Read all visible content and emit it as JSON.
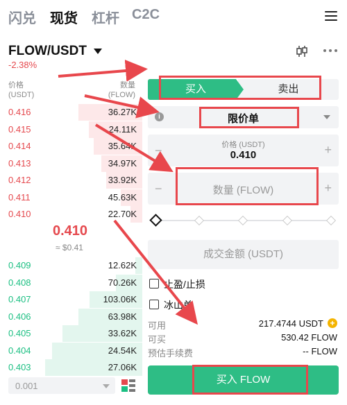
{
  "top_tabs": [
    "闪兑",
    "现货",
    "杠杆",
    "C2C"
  ],
  "pair": {
    "name": "FLOW/USDT",
    "change": "-2.38%"
  },
  "orderbook": {
    "price_header": "价格\n(USDT)",
    "qty_header": "数量\n(FLOW)",
    "asks": [
      {
        "price": "0.416",
        "qty": "36.27K",
        "depth": 0.66
      },
      {
        "price": "0.415",
        "qty": "24.11K",
        "depth": 0.55
      },
      {
        "price": "0.414",
        "qty": "35.64K",
        "depth": 0.5
      },
      {
        "price": "0.413",
        "qty": "34.97K",
        "depth": 0.42
      },
      {
        "price": "0.412",
        "qty": "33.92K",
        "depth": 0.37
      },
      {
        "price": "0.411",
        "qty": "45.63K",
        "depth": 0.22
      },
      {
        "price": "0.410",
        "qty": "22.70K",
        "depth": 0.12
      }
    ],
    "last_price": "0.410",
    "last_price_usd": "≈ $0.41",
    "bids": [
      {
        "price": "0.409",
        "qty": "12.62K",
        "depth": 0.07
      },
      {
        "price": "0.408",
        "qty": "70.26K",
        "depth": 0.27
      },
      {
        "price": "0.407",
        "qty": "103.06K",
        "depth": 0.54
      },
      {
        "price": "0.406",
        "qty": "63.98K",
        "depth": 0.66
      },
      {
        "price": "0.405",
        "qty": "33.62K",
        "depth": 0.82
      },
      {
        "price": "0.404",
        "qty": "24.54K",
        "depth": 0.93
      },
      {
        "price": "0.403",
        "qty": "27.06K",
        "depth": 1.0
      }
    ],
    "precision": "0.001"
  },
  "trade": {
    "buy_tab": "买入",
    "sell_tab": "卖出",
    "order_type": "限价单",
    "price_label": "价格 (USDT)",
    "price_value": "0.410",
    "qty_placeholder": "数量 (FLOW)",
    "total_placeholder": "成交金额 (USDT)",
    "tp_sl_label": "止盈/止损",
    "iceberg_label": "冰山单",
    "available_label": "可用",
    "available_value": "217.4744 USDT",
    "can_buy_label": "可买",
    "can_buy_value": "530.42 FLOW",
    "fee_label": "预估手续费",
    "fee_value": "-- FLOW",
    "buy_button": "买入 FLOW"
  },
  "colors": {
    "up": "#1bbf82",
    "down": "#e5484d",
    "buy": "#2ebd85",
    "annotation": "#e8474c"
  }
}
